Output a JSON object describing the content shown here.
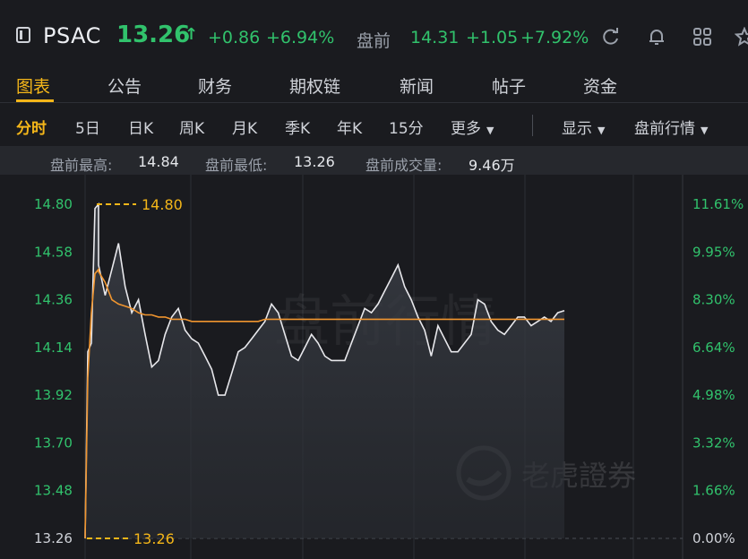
{
  "header": {
    "symbol": "PSAC",
    "price": "13.26",
    "arrow": "↑",
    "change": "+0.86",
    "change_pct": "+6.94%",
    "premarket_label": "盘前",
    "premarket_price": "14.31",
    "premarket_change": "+1.05",
    "premarket_pct": "+7.92%"
  },
  "tabs": [
    {
      "label": "图表"
    },
    {
      "label": "公告"
    },
    {
      "label": "财务"
    },
    {
      "label": "期权链"
    },
    {
      "label": "新闻"
    },
    {
      "label": "帖子"
    },
    {
      "label": "资金"
    }
  ],
  "periods": {
    "items": [
      {
        "label": "分时"
      },
      {
        "label": "5日"
      },
      {
        "label": "日K"
      },
      {
        "label": "周K"
      },
      {
        "label": "月K"
      },
      {
        "label": "季K"
      },
      {
        "label": "年K"
      },
      {
        "label": "15分"
      }
    ],
    "more": "更多",
    "display": "显示",
    "premarket_quotes": "盘前行情"
  },
  "stats": {
    "high_label": "盘前最高:",
    "high_value": "14.84",
    "low_label": "盘前最低:",
    "low_value": "13.26",
    "vol_label": "盘前成交量:",
    "vol_value": "9.46万"
  },
  "watermark": {
    "text": "盘前行情",
    "brand": "老虎證券"
  },
  "colors": {
    "up": "#31c26c",
    "accent": "#f4b619",
    "price_line": "#e8e8ec",
    "avg_line": "#f0952f"
  },
  "chart_data": {
    "type": "line",
    "ylim": [
      13.26,
      14.8
    ],
    "y_ticks": [
      "14.80",
      "14.58",
      "14.36",
      "14.14",
      "13.92",
      "13.70",
      "13.48",
      "13.26"
    ],
    "pct_ticks": [
      "11.61%",
      "9.95%",
      "8.30%",
      "6.64%",
      "4.98%",
      "3.32%",
      "1.66%",
      "0.00%"
    ],
    "high_marker": "14.80",
    "low_marker": "13.26",
    "series": [
      {
        "values": [
          13.26,
          14.12,
          14.16,
          14.78,
          14.8,
          14.52,
          14.38,
          14.5,
          14.62,
          14.42,
          14.3,
          14.36,
          14.2,
          14.05,
          14.08,
          14.2,
          14.28,
          14.32,
          14.22,
          14.18,
          14.16,
          14.1,
          14.04,
          13.92,
          13.92,
          14.02,
          14.12,
          14.14,
          14.18,
          14.22,
          14.26,
          14.34,
          14.3,
          14.2,
          14.1,
          14.08,
          14.14,
          14.2,
          14.16,
          14.1,
          14.08,
          14.08,
          14.08,
          14.16,
          14.24,
          14.32,
          14.3,
          14.34,
          14.4,
          14.46,
          14.52,
          14.42,
          14.36,
          14.28,
          14.22,
          14.1,
          14.24,
          14.18,
          14.12,
          14.12,
          14.16,
          14.2,
          14.36,
          14.34,
          14.26,
          14.22,
          14.2,
          14.24,
          14.28,
          14.28,
          14.24,
          14.26,
          14.28,
          14.26,
          14.3,
          14.31
        ]
      },
      {
        "values": [
          13.26,
          14.0,
          14.3,
          14.48,
          14.5,
          14.49,
          14.44,
          14.36,
          14.34,
          14.33,
          14.32,
          14.3,
          14.29,
          14.29,
          14.28,
          14.28,
          14.27,
          14.27,
          14.27,
          14.26,
          14.26,
          14.26,
          14.26,
          14.26,
          14.26,
          14.26,
          14.26,
          14.26,
          14.26,
          14.26,
          14.27,
          14.27,
          14.27,
          14.27,
          14.27,
          14.27,
          14.27,
          14.27,
          14.27,
          14.27,
          14.27,
          14.27,
          14.27,
          14.27,
          14.27,
          14.27,
          14.27,
          14.27,
          14.27,
          14.27,
          14.27,
          14.27,
          14.27,
          14.27,
          14.27,
          14.27,
          14.27,
          14.27,
          14.27,
          14.27,
          14.27,
          14.27,
          14.27,
          14.27,
          14.27,
          14.27,
          14.27,
          14.27,
          14.27,
          14.27,
          14.27,
          14.27,
          14.27,
          14.27,
          14.27,
          14.27
        ]
      }
    ]
  }
}
